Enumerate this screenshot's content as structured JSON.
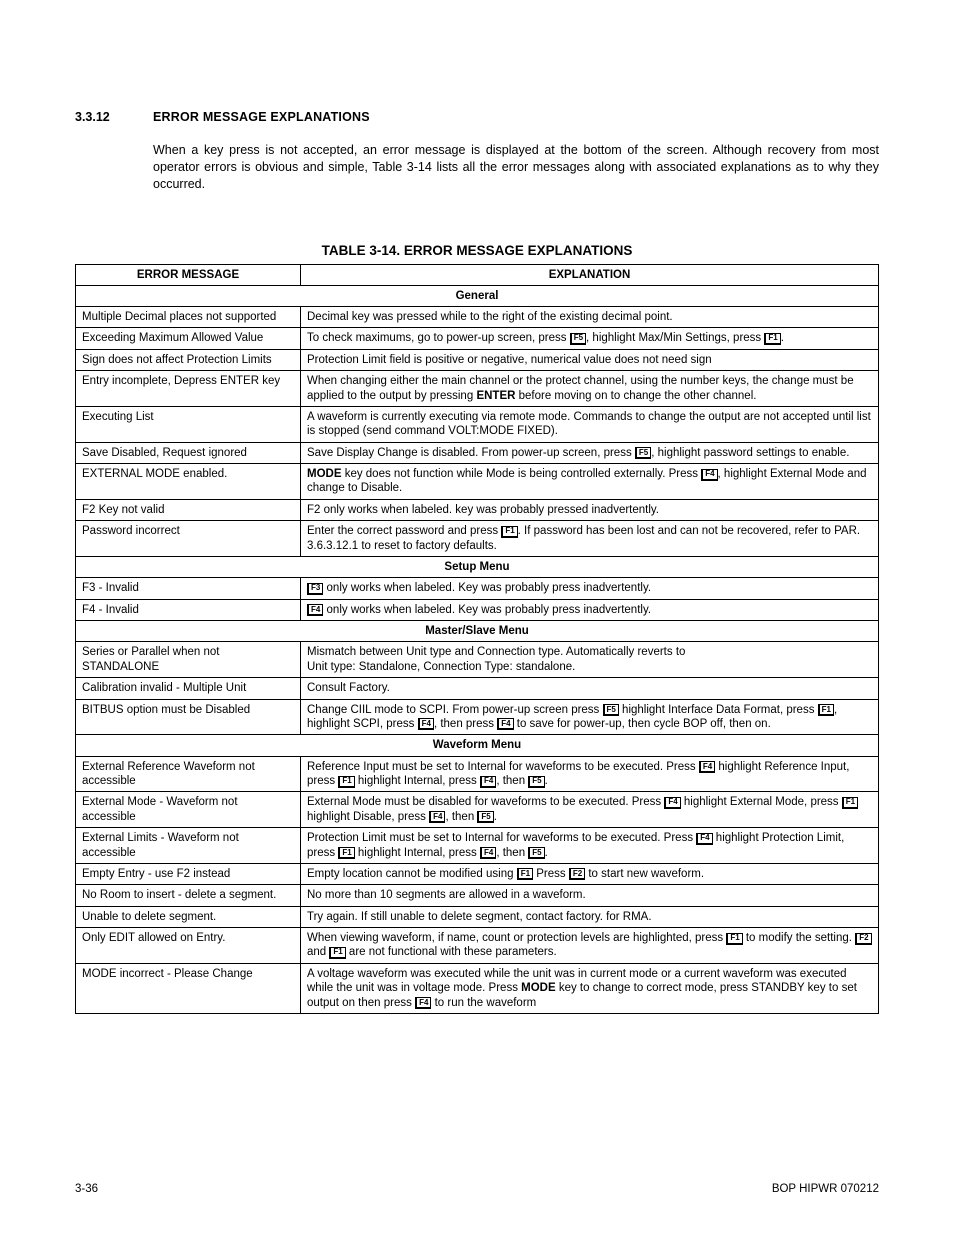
{
  "section": {
    "number": "3.3.12",
    "title": "ERROR MESSAGE EXPLANATIONS"
  },
  "intro": "When a key press is not accepted, an error message is displayed at the bottom of the screen. Although recovery from most operator errors is obvious and simple, Table 3-14 lists all the error messages along with associated explanations as to why they occurred.",
  "tableCaption": "TABLE 3-14.  ERROR MESSAGE EXPLANATIONS",
  "headers": {
    "msg": "ERROR MESSAGE",
    "exp": "EXPLANATION"
  },
  "sections": {
    "general": "General",
    "setup": "Setup Menu",
    "master": "Master/Slave Menu",
    "waveform": "Waveform Menu"
  },
  "keys": {
    "f1": "F1",
    "f2": "F2",
    "f3": "F3",
    "f4": "F4",
    "f5": "F5"
  },
  "rows": {
    "r1": {
      "msg": "Multiple Decimal places not supported",
      "exp": "Decimal key was pressed while to the right of the existing decimal point."
    },
    "r2": {
      "msg": "Exceeding Maximum Allowed Value",
      "exp_a": "To check maximums, go to power-up screen, press ",
      "exp_b": ", highlight Max/Min Settings, press ",
      "exp_c": "."
    },
    "r3": {
      "msg": "Sign does not affect Protection Limits",
      "exp": "Protection Limit field is positive or negative, numerical value does not need sign"
    },
    "r4": {
      "msg": "Entry incomplete, Depress ENTER key",
      "exp_a": "When changing either the main channel or the protect channel, using the number keys, the change must be applied to the output by pressing ",
      "bold": "ENTER",
      "exp_b": " before moving on to change the other channel."
    },
    "r5": {
      "msg": "Executing List",
      "exp": "A waveform is currently executing via remote mode. Commands to change the output are not accepted until list is stopped (send command VOLT:MODE FIXED)."
    },
    "r6": {
      "msg": "Save Disabled, Request ignored",
      "exp_a": "Save Display Change is disabled. From power-up screen, press ",
      "exp_b": ", highlight password settings to enable."
    },
    "r7": {
      "msg": "EXTERNAL MODE enabled.",
      "bold": "MODE",
      "exp_a": " key does not function while Mode is being controlled externally. Press ",
      "exp_b": ", highlight External Mode and change to Disable."
    },
    "r8": {
      "msg": "F2 Key not valid",
      "exp": "F2 only works when labeled. key was probably pressed inadvertently."
    },
    "r9": {
      "msg": "Password incorrect",
      "exp_a": "Enter the correct password and press ",
      "exp_b": ". If password has been lost and can not be recovered, refer to PAR. 3.6.3.12.1 to reset to factory defaults."
    },
    "r10": {
      "msg": "F3 - Invalid",
      "exp": " only works when labeled. Key was probably press inadvertently."
    },
    "r11": {
      "msg": "F4 - Invalid",
      "exp": " only works when labeled. Key was probably press inadvertently."
    },
    "r12": {
      "msg": "Series or Parallel when not STANDALONE",
      "exp": "Mismatch between Unit type and Connection type. Automatically reverts to\nUnit type: Standalone, Connection Type: standalone."
    },
    "r13": {
      "msg": "Calibration invalid - Multiple Unit",
      "exp": "Consult Factory."
    },
    "r14": {
      "msg": "BITBUS option must be Disabled",
      "a": "Change CIIL mode to SCPI. From power-up screen press ",
      "b": " highlight Interface Data Format, press ",
      "c": ", highlight SCPI, press ",
      "d": ", then press ",
      "e": " to save for power-up, then cycle BOP off, then on."
    },
    "r15": {
      "msg": "External Reference Waveform not accessible",
      "a": "Reference Input must be set to Internal for waveforms to be executed. Press ",
      "b": " highlight Reference Input, press ",
      "c": " highlight Internal, press ",
      "d": ", then ",
      "e": "."
    },
    "r16": {
      "msg": "External Mode - Waveform not accessible",
      "a": "External Mode must be disabled for waveforms to be executed. Press ",
      "b": " highlight External Mode, press ",
      "c": " highlight Disable, press ",
      "d": ", then ",
      "e": "."
    },
    "r17": {
      "msg": "External Limits - Waveform not accessible",
      "a": "Protection Limit must be set to Internal for waveforms to be executed. Press ",
      "b": " highlight Protection Limit, press ",
      "c": " highlight Internal, press ",
      "d": ", then ",
      "e": "."
    },
    "r18": {
      "msg": "Empty Entry - use F2 instead",
      "a": "Empty location cannot be modified using ",
      "b": " Press ",
      "c": " to start new waveform."
    },
    "r19": {
      "msg": "No Room to insert - delete a segment.",
      "exp": "No more than 10 segments are allowed in a waveform."
    },
    "r20": {
      "msg": "Unable to delete segment.",
      "exp": "Try again. If still unable to delete segment, contact factory. for RMA."
    },
    "r21": {
      "msg": "Only EDIT allowed on Entry.",
      "a": "When viewing waveform, if name, count or protection levels are highlighted, press ",
      "b": " to modify the setting. ",
      "c": " and ",
      "d": " are not functional with these parameters."
    },
    "r22": {
      "msg": "MODE incorrect - Please Change",
      "a": "A voltage waveform was executed while the unit was in current mode or a current waveform was executed while the unit was in voltage mode. Press ",
      "bold": "MODE",
      "b": " key to change to correct mode, press STANDBY key to set output on then press ",
      "c": " to run the waveform"
    }
  },
  "footer": {
    "left": "3-36",
    "right": "BOP HIPWR 070212"
  }
}
